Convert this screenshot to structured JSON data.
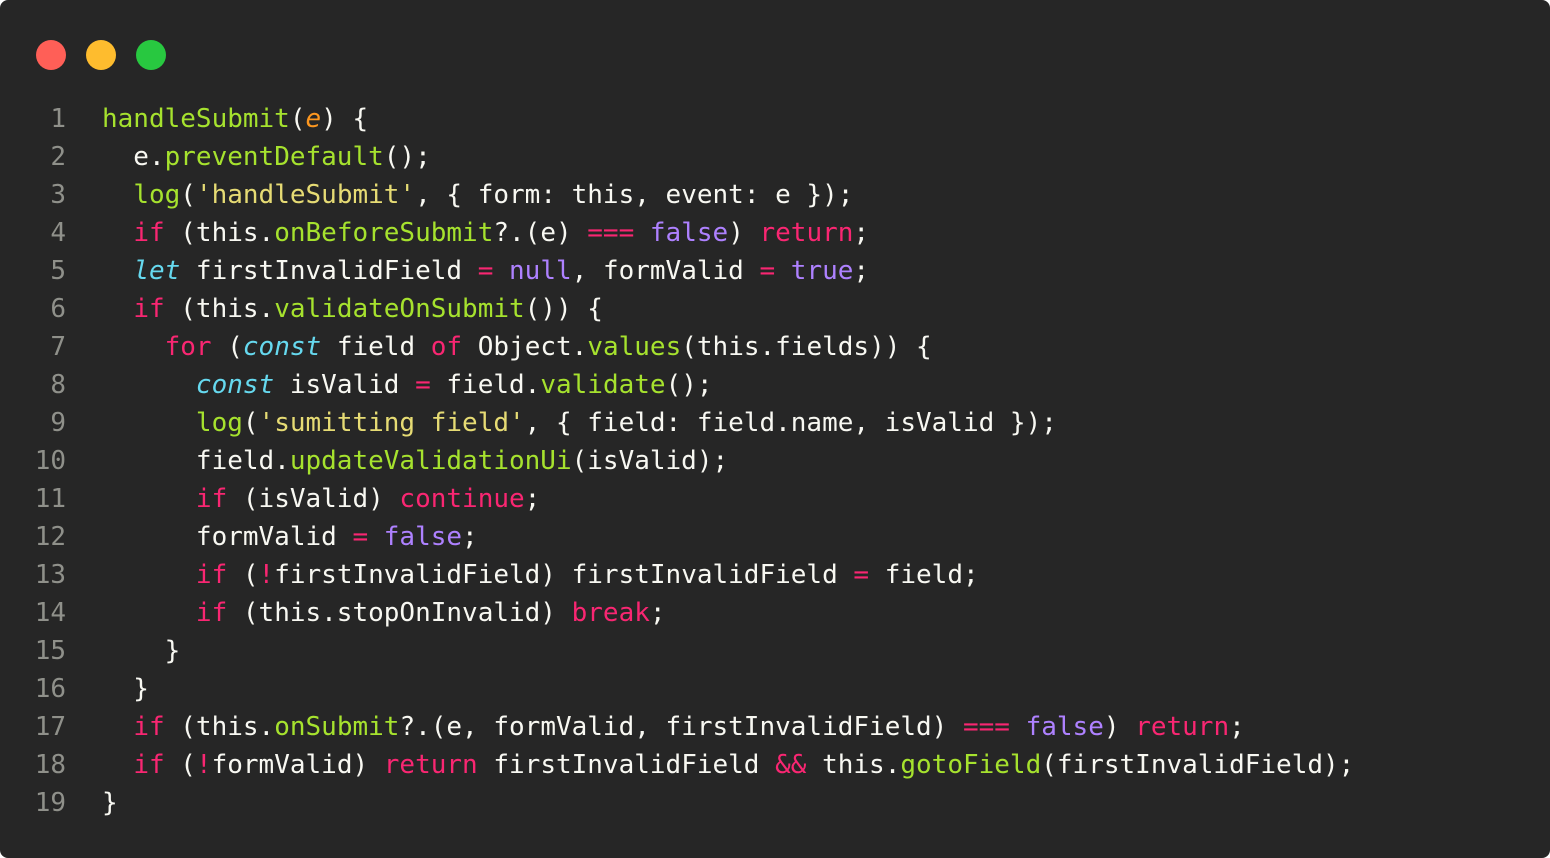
{
  "window": {
    "controls": [
      {
        "name": "close-button",
        "color": "#ff5f57"
      },
      {
        "name": "minimize-button",
        "color": "#febc2e"
      },
      {
        "name": "maximize-button",
        "color": "#28c840"
      }
    ]
  },
  "code": {
    "lines": [
      [
        [
          "fn",
          "handleSubmit"
        ],
        [
          "plain",
          "("
        ],
        [
          "param",
          "e"
        ],
        [
          "plain",
          ") {"
        ]
      ],
      [
        [
          "plain",
          "  e."
        ],
        [
          "fn",
          "preventDefault"
        ],
        [
          "plain",
          "();"
        ]
      ],
      [
        [
          "plain",
          "  "
        ],
        [
          "fn",
          "log"
        ],
        [
          "plain",
          "("
        ],
        [
          "str",
          "'handleSubmit'"
        ],
        [
          "plain",
          ", { form: this, event: e });"
        ]
      ],
      [
        [
          "plain",
          "  "
        ],
        [
          "kw",
          "if"
        ],
        [
          "plain",
          " (this."
        ],
        [
          "fn",
          "onBeforeSubmit"
        ],
        [
          "plain",
          "?.(e) "
        ],
        [
          "op",
          "==="
        ],
        [
          "plain",
          " "
        ],
        [
          "const",
          "false"
        ],
        [
          "plain",
          ") "
        ],
        [
          "kw",
          "return"
        ],
        [
          "plain",
          ";"
        ]
      ],
      [
        [
          "plain",
          "  "
        ],
        [
          "decl",
          "let"
        ],
        [
          "plain",
          " firstInvalidField "
        ],
        [
          "op",
          "="
        ],
        [
          "plain",
          " "
        ],
        [
          "const",
          "null"
        ],
        [
          "plain",
          ", formValid "
        ],
        [
          "op",
          "="
        ],
        [
          "plain",
          " "
        ],
        [
          "const",
          "true"
        ],
        [
          "plain",
          ";"
        ]
      ],
      [
        [
          "plain",
          "  "
        ],
        [
          "kw",
          "if"
        ],
        [
          "plain",
          " (this."
        ],
        [
          "fn",
          "validateOnSubmit"
        ],
        [
          "plain",
          "()) {"
        ]
      ],
      [
        [
          "plain",
          "    "
        ],
        [
          "kw",
          "for"
        ],
        [
          "plain",
          " ("
        ],
        [
          "decl",
          "const"
        ],
        [
          "plain",
          " field "
        ],
        [
          "kw",
          "of"
        ],
        [
          "plain",
          " Object."
        ],
        [
          "fn",
          "values"
        ],
        [
          "plain",
          "(this.fields)) {"
        ]
      ],
      [
        [
          "plain",
          "      "
        ],
        [
          "decl",
          "const"
        ],
        [
          "plain",
          " isValid "
        ],
        [
          "op",
          "="
        ],
        [
          "plain",
          " field."
        ],
        [
          "fn",
          "validate"
        ],
        [
          "plain",
          "();"
        ]
      ],
      [
        [
          "plain",
          "      "
        ],
        [
          "fn",
          "log"
        ],
        [
          "plain",
          "("
        ],
        [
          "str",
          "'sumitting field'"
        ],
        [
          "plain",
          ", { field: field.name, isValid });"
        ]
      ],
      [
        [
          "plain",
          "      field."
        ],
        [
          "fn",
          "updateValidationUi"
        ],
        [
          "plain",
          "(isValid);"
        ]
      ],
      [
        [
          "plain",
          "      "
        ],
        [
          "kw",
          "if"
        ],
        [
          "plain",
          " (isValid) "
        ],
        [
          "kw",
          "continue"
        ],
        [
          "plain",
          ";"
        ]
      ],
      [
        [
          "plain",
          "      formValid "
        ],
        [
          "op",
          "="
        ],
        [
          "plain",
          " "
        ],
        [
          "const",
          "false"
        ],
        [
          "plain",
          ";"
        ]
      ],
      [
        [
          "plain",
          "      "
        ],
        [
          "kw",
          "if"
        ],
        [
          "plain",
          " ("
        ],
        [
          "op",
          "!"
        ],
        [
          "plain",
          "firstInvalidField) firstInvalidField "
        ],
        [
          "op",
          "="
        ],
        [
          "plain",
          " field;"
        ]
      ],
      [
        [
          "plain",
          "      "
        ],
        [
          "kw",
          "if"
        ],
        [
          "plain",
          " (this.stopOnInvalid) "
        ],
        [
          "kw",
          "break"
        ],
        [
          "plain",
          ";"
        ]
      ],
      [
        [
          "plain",
          "    }"
        ]
      ],
      [
        [
          "plain",
          "  }"
        ]
      ],
      [
        [
          "plain",
          "  "
        ],
        [
          "kw",
          "if"
        ],
        [
          "plain",
          " (this."
        ],
        [
          "fn",
          "onSubmit"
        ],
        [
          "plain",
          "?.(e, formValid, firstInvalidField) "
        ],
        [
          "op",
          "==="
        ],
        [
          "plain",
          " "
        ],
        [
          "const",
          "false"
        ],
        [
          "plain",
          ") "
        ],
        [
          "kw",
          "return"
        ],
        [
          "plain",
          ";"
        ]
      ],
      [
        [
          "plain",
          "  "
        ],
        [
          "kw",
          "if"
        ],
        [
          "plain",
          " ("
        ],
        [
          "op",
          "!"
        ],
        [
          "plain",
          "formValid) "
        ],
        [
          "kw",
          "return"
        ],
        [
          "plain",
          " firstInvalidField "
        ],
        [
          "op",
          "&&"
        ],
        [
          "plain",
          " this."
        ],
        [
          "fn",
          "gotoField"
        ],
        [
          "plain",
          "(firstInvalidField);"
        ]
      ],
      [
        [
          "plain",
          "}"
        ]
      ]
    ]
  }
}
